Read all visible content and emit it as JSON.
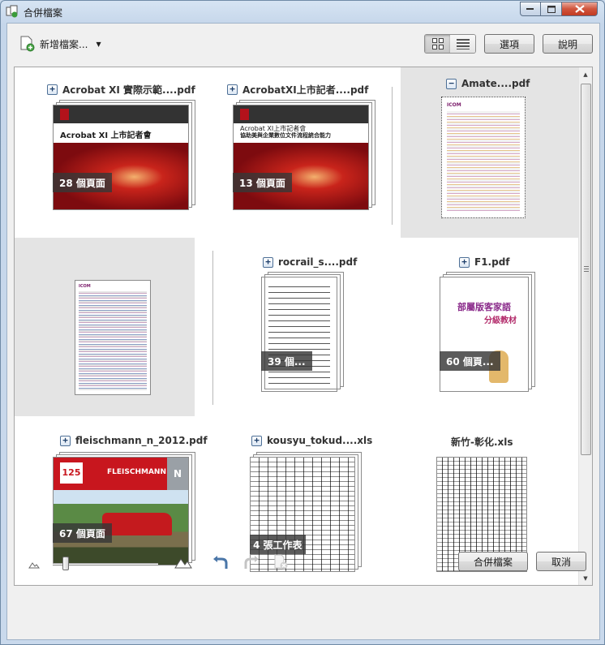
{
  "window": {
    "title": "合併檔案"
  },
  "toolbar": {
    "add_files_label": "新增檔案...",
    "options_label": "選項",
    "help_label": "說明"
  },
  "files": [
    {
      "name": "Acrobat XI 實際示範....pdf",
      "badge": "28 個頁面",
      "toggle": "+",
      "thumb_title": "Acrobat XI 上市記者會"
    },
    {
      "name": "AcrobatXI上市記者....pdf",
      "badge": "13 個頁面",
      "toggle": "+",
      "thumb_title": "Acrobat XI上市記者會",
      "thumb_sub": "協助美與企業數位文件流程統合能力"
    },
    {
      "name": "Amate....pdf",
      "badge": "",
      "toggle": "−",
      "thumb_logo": "ICOM"
    },
    {
      "name": "",
      "badge": "",
      "thumb_logo": "ICOM"
    },
    {
      "name": "rocrail_s....pdf",
      "badge": "39 個...",
      "toggle": "+"
    },
    {
      "name": "F1.pdf",
      "badge": "60 個頁...",
      "toggle": "+",
      "thumb_title": "部屬版客家語",
      "thumb_sub": "分級教材"
    },
    {
      "name": "fleischmann_n_2012.pdf",
      "badge": "67 個頁面",
      "toggle": "+",
      "thumb_brand": "FLEISCHMANN",
      "thumb_num": "125",
      "thumb_scale": "N"
    },
    {
      "name": "kousyu_tokud....xls",
      "badge": "4 張工作表",
      "toggle": "+"
    },
    {
      "name": "新竹-彰化.xls",
      "badge": ""
    }
  ],
  "footer": {
    "combine_label": "合併檔案",
    "cancel_label": "取消"
  },
  "colors": {
    "acrobat_red": "#b3121b",
    "selection": "#e4e4e4",
    "window_frame": "#c9d9ec"
  }
}
